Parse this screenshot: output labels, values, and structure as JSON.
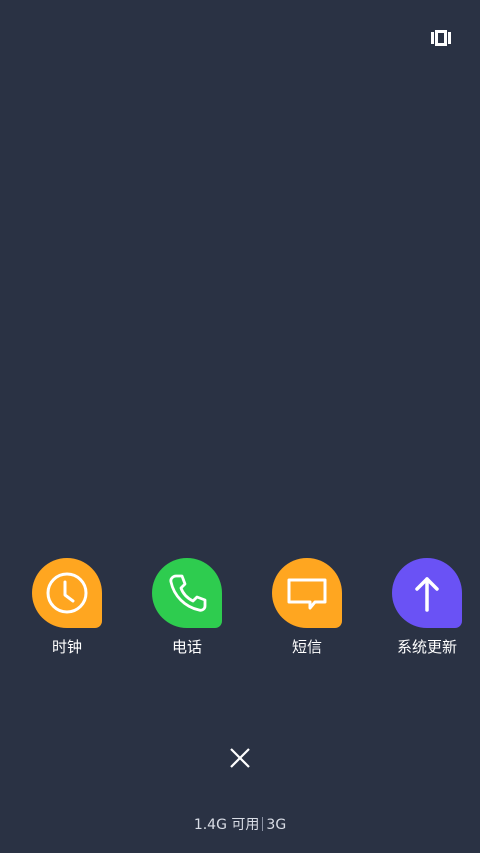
{
  "background_color": "#2a3244",
  "top_right": {
    "icon": "lock-recents-icon"
  },
  "apps": [
    {
      "label": "时钟",
      "icon": "clock-icon",
      "color": "#ffa620"
    },
    {
      "label": "电话",
      "icon": "phone-icon",
      "color": "#2ecc4f"
    },
    {
      "label": "短信",
      "icon": "message-icon",
      "color": "#ffa620"
    },
    {
      "label": "系统更新",
      "icon": "update-arrow-icon",
      "color": "#6a52f5"
    }
  ],
  "close_button": {
    "icon": "close-icon"
  },
  "memory": {
    "available": "1.4G 可用",
    "total": "3G"
  }
}
